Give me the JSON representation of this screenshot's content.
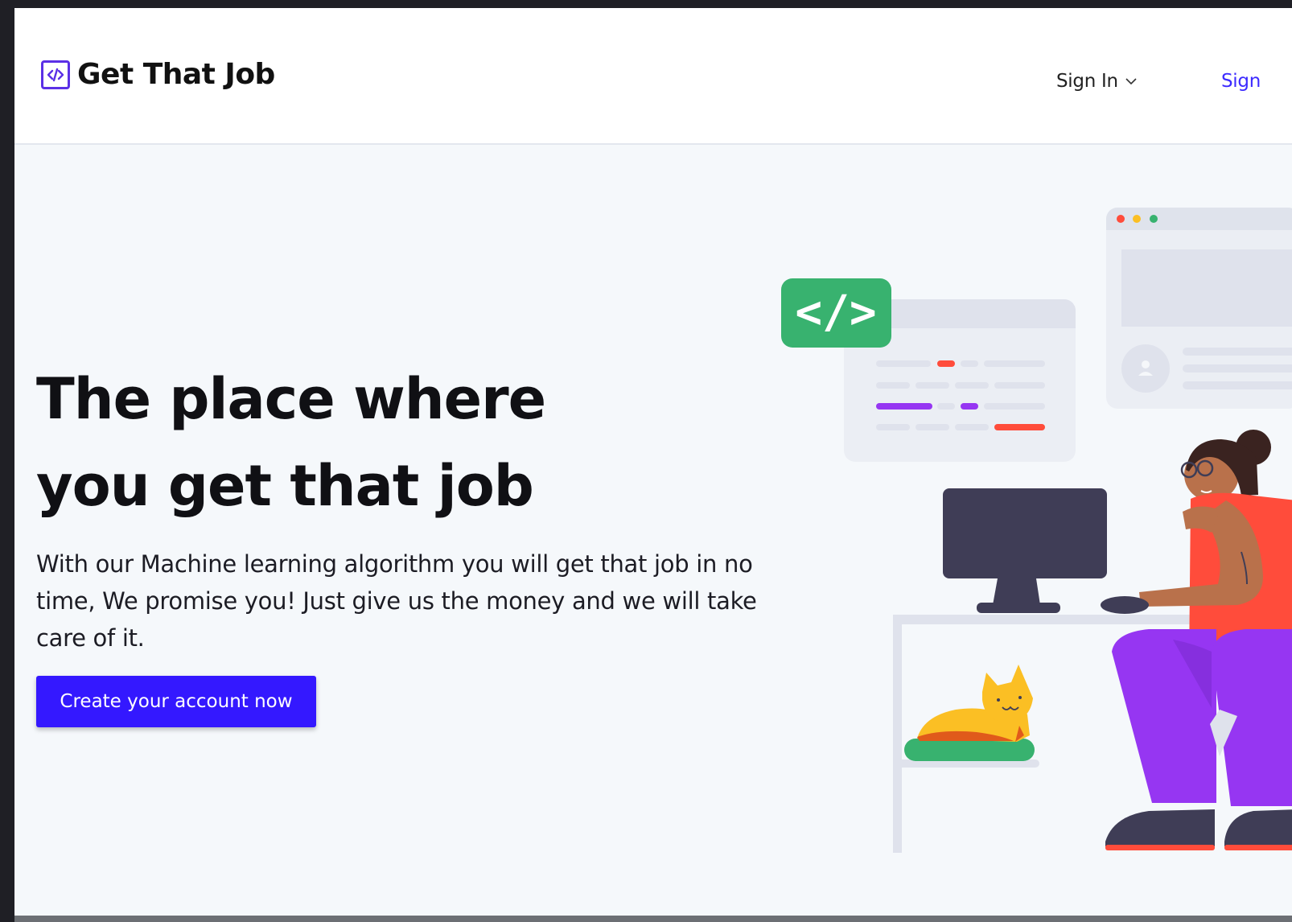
{
  "header": {
    "brand_name": "Get That Job",
    "brand_icon": "code-icon",
    "sign_in_label": "Sign In",
    "sign_up_label": "Sign"
  },
  "hero": {
    "headline_line1": "The place where",
    "headline_line2": "you get that job",
    "description": "With our Machine learning algorithm you will get that job in no time, We promise you! Just give us the money and we will take care of it.",
    "cta_label": "Create your account now",
    "code_badge": "</>"
  },
  "colors": {
    "brand_accent": "#5b30e6",
    "cta_background": "#3418ff",
    "sign_up_link": "#3d2bff",
    "code_badge_green": "#38b26f",
    "pants_purple": "#9636f2"
  }
}
